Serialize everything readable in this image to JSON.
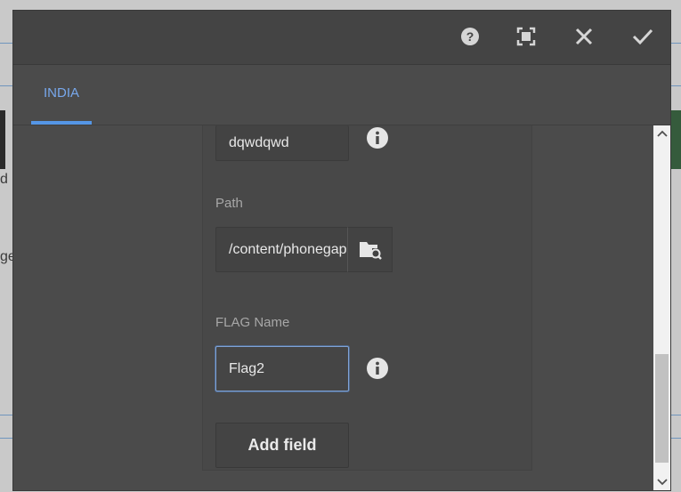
{
  "toolbar": {
    "help_icon": "help-circle-icon",
    "fullscreen_icon": "fullscreen-icon",
    "close_icon": "close-icon",
    "done_icon": "checkmark-icon"
  },
  "tabs": [
    {
      "label": "INDIA",
      "selected": true
    }
  ],
  "form": {
    "top_field": {
      "value": "dqwdqwd"
    },
    "path_field": {
      "label": "Path",
      "value": "/content/phonegap"
    },
    "flag_field": {
      "label": "FLAG Name",
      "value": "Flag2"
    },
    "add_field_label": "Add field"
  },
  "background": {
    "fragment_1": "d",
    "fragment_2": "ge"
  },
  "colors": {
    "accent": "#5596e6",
    "dialog_bg": "#4b4b4b",
    "focus_border": "#7fa3d6"
  }
}
